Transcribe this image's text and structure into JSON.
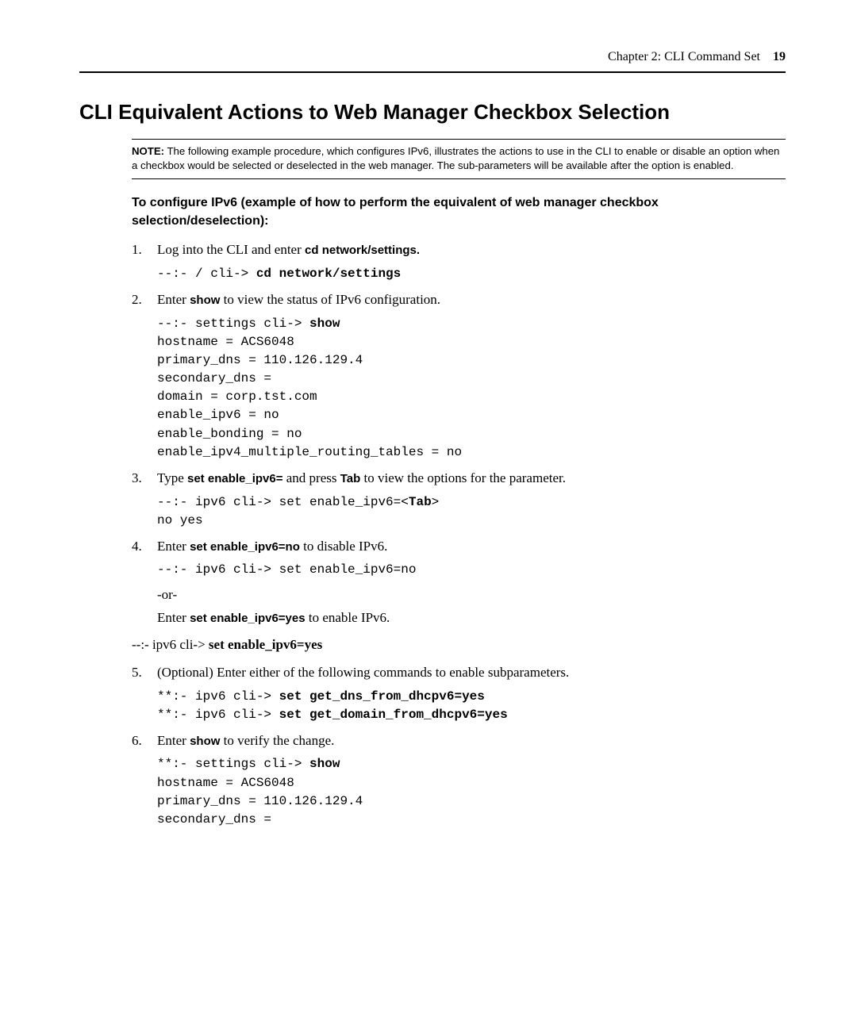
{
  "header": {
    "chapter": "Chapter 2: CLI Command Set",
    "page": "19"
  },
  "h1": "CLI Equivalent Actions to Web Manager Checkbox Selection",
  "note": {
    "label": "NOTE:",
    "text": " The following example procedure, which configures IPv6, illustrates the actions to use in the CLI to enable or disable an option when a checkbox would be selected or deselected in the web manager. The sub-parameters will be available after the option is enabled."
  },
  "subhead": "To configure IPv6 (example of how to perform the equivalent of web manager checkbox selection/deselection):",
  "steps": {
    "s1": {
      "num": "1.",
      "pre": "Log into the CLI and enter ",
      "bold": "cd network/settings.",
      "code_pre": "--:- / cli-> ",
      "code_bold": "cd network/settings"
    },
    "s2": {
      "num": "2.",
      "pre": "Enter ",
      "bold": "show",
      "post": " to view the status of IPv6 configuration.",
      "code_l1a": "--:- settings cli-> ",
      "code_l1b": "show",
      "code_l2": "hostname = ACS6048",
      "code_l3": "primary_dns = 110.126.129.4",
      "code_l4": "secondary_dns =",
      "code_l5": "domain = corp.tst.com",
      "code_l6": "enable_ipv6 = no",
      "code_l7": "enable_bonding = no",
      "code_l8": "enable_ipv4_multiple_routing_tables = no"
    },
    "s3": {
      "num": "3.",
      "pre": "Type ",
      "bold1": "set enable_ipv6=",
      "mid": " and press ",
      "bold2": "Tab",
      "post": " to view the options for the parameter.",
      "code_l1a": "--:- ipv6 cli-> set enable_ipv6=<",
      "code_l1b": "Tab",
      "code_l1c": ">",
      "code_l2": "no yes"
    },
    "s4": {
      "num": "4.",
      "pre": "Enter ",
      "bold1": "set enable_ipv6=no",
      "post1": " to disable IPv6.",
      "code_l1": "--:- ipv6 cli-> set enable_ipv6=no",
      "or": "-or-",
      "pre2": "Enter ",
      "bold2": "set enable_ipv6=yes",
      "post2": " to enable IPv6.",
      "after_pre": "--:- ipv6 cli-> ",
      "after_bold": "set enable_ipv6=yes"
    },
    "s5": {
      "num": "5.",
      "text": "(Optional) Enter either of the following commands to enable subparameters.",
      "code_l1a": "**:- ipv6 cli-> ",
      "code_l1b": "set get_dns_from_dhcpv6=yes",
      "code_l2a": "**:- ipv6 cli-> ",
      "code_l2b": "set get_domain_from_dhcpv6=yes"
    },
    "s6": {
      "num": "6.",
      "pre": "Enter ",
      "bold": "show",
      "post": " to verify the change.",
      "code_l1a": "**:- settings cli-> ",
      "code_l1b": "show",
      "code_l2": "hostname = ACS6048",
      "code_l3": "primary_dns = 110.126.129.4",
      "code_l4": "secondary_dns ="
    }
  }
}
